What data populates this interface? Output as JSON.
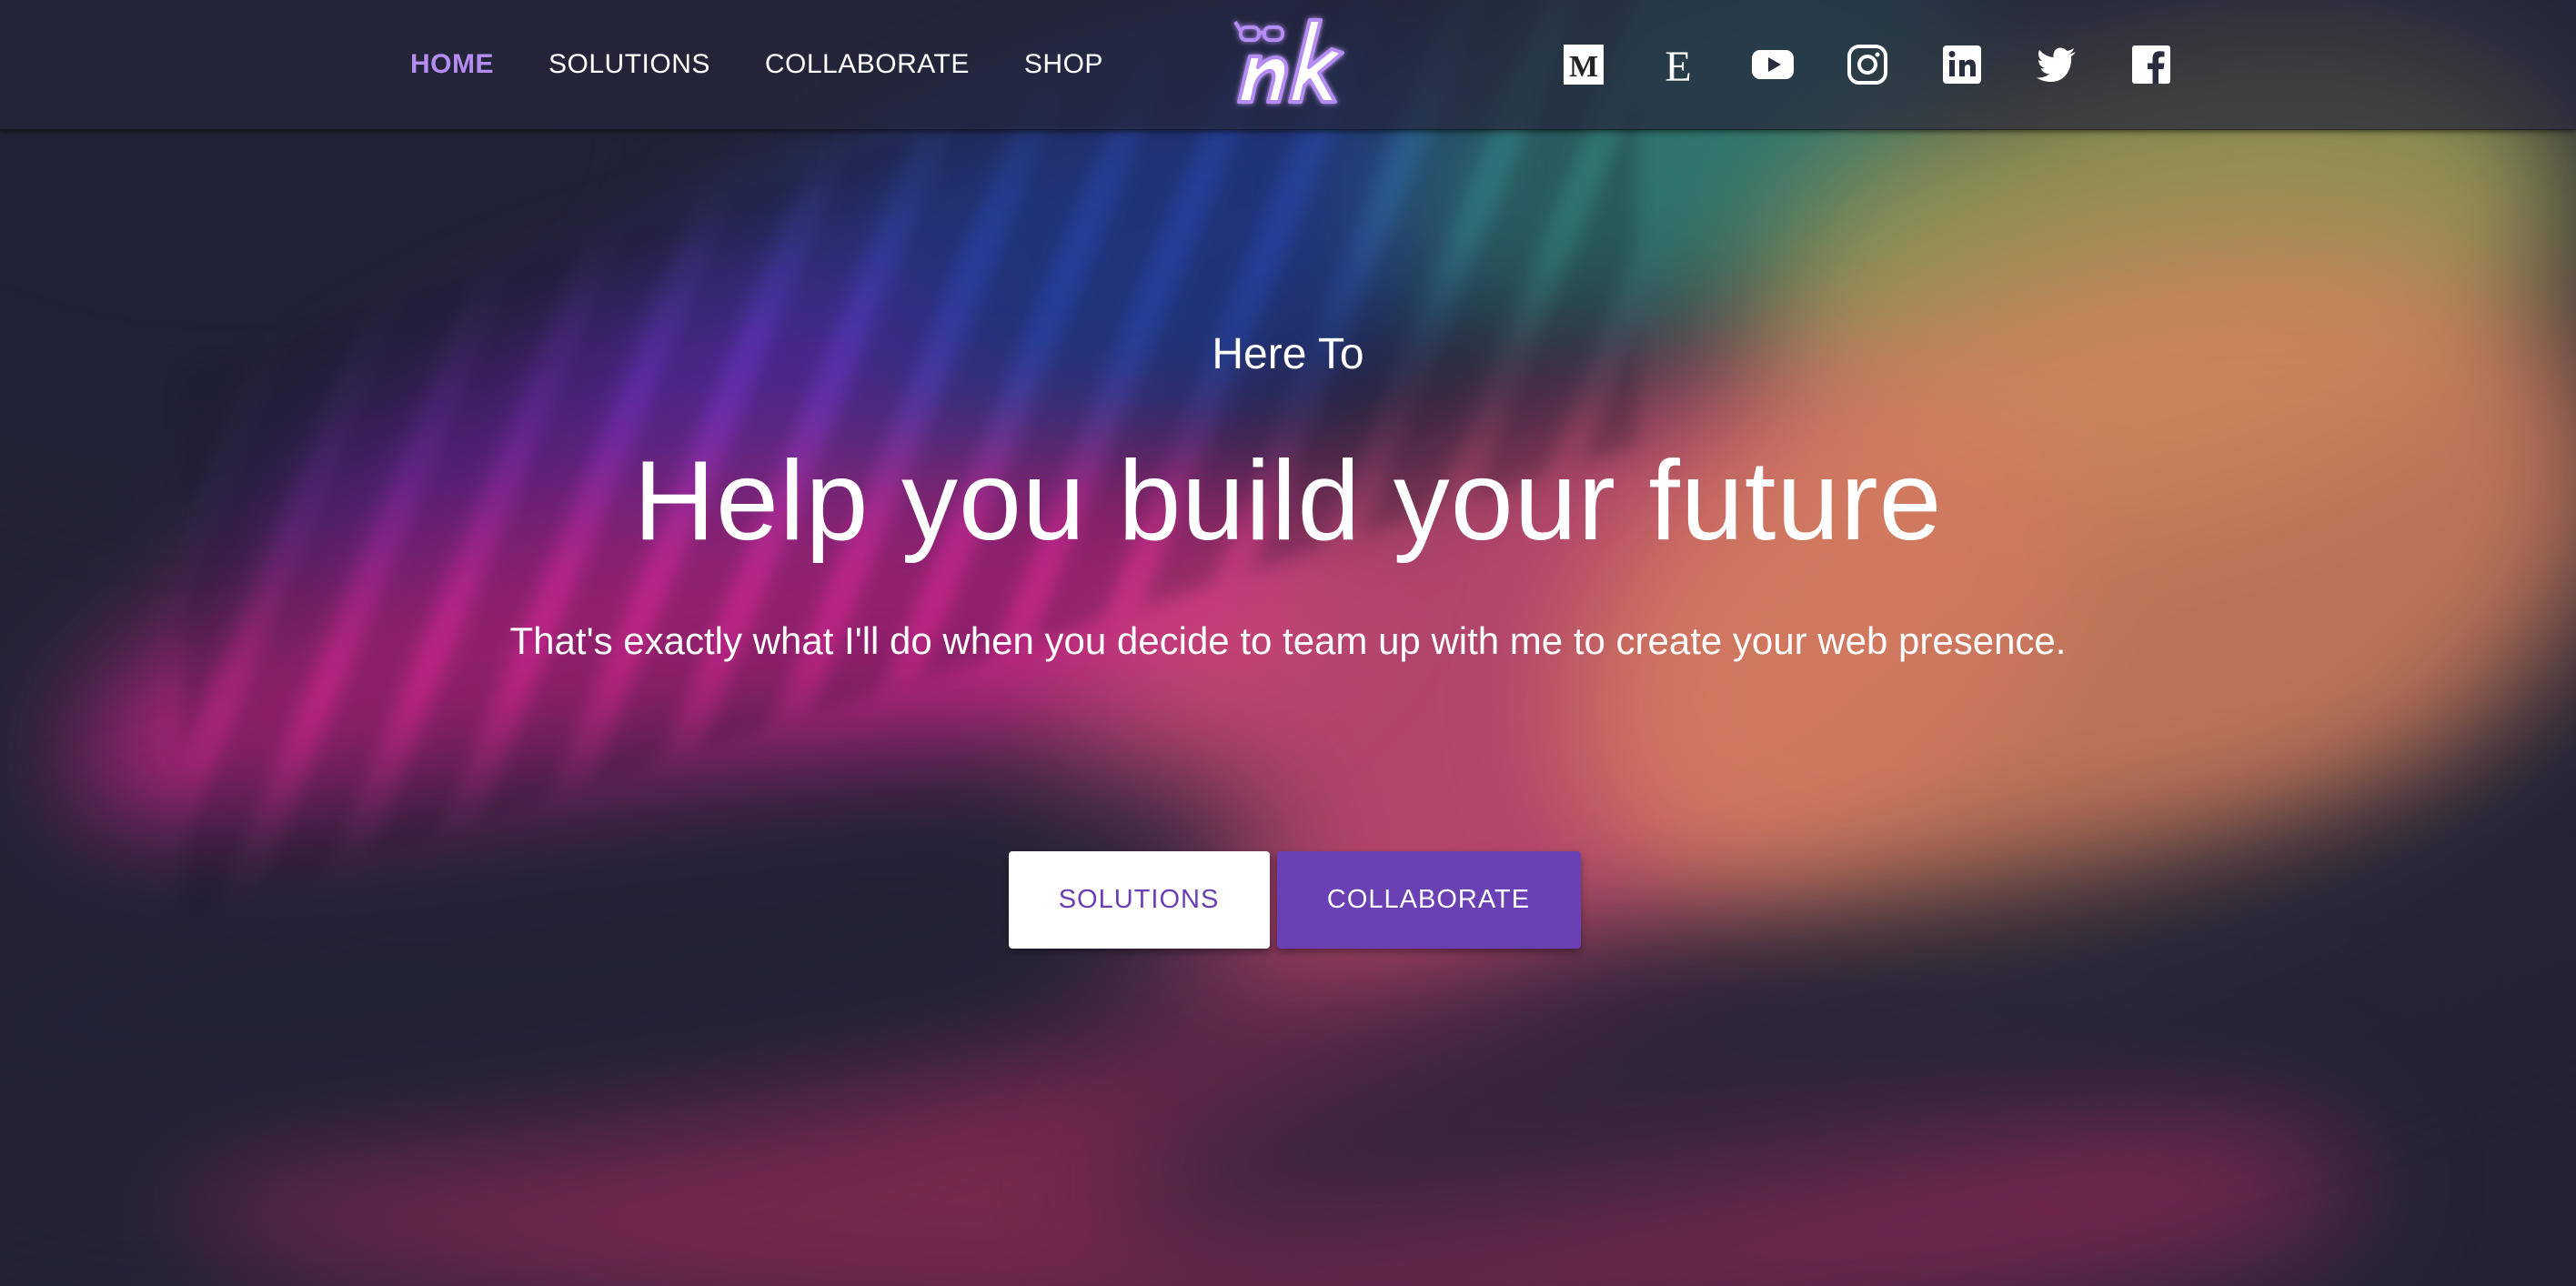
{
  "nav": {
    "items": [
      {
        "label": "HOME",
        "active": true
      },
      {
        "label": "SOLUTIONS",
        "active": false
      },
      {
        "label": "COLLABORATE",
        "active": false
      },
      {
        "label": "SHOP",
        "active": false
      }
    ]
  },
  "logo": {
    "text": "nk",
    "icon": "glasses-icon"
  },
  "social": [
    {
      "name": "medium-icon"
    },
    {
      "name": "etsy-icon"
    },
    {
      "name": "youtube-icon"
    },
    {
      "name": "instagram-icon"
    },
    {
      "name": "linkedin-icon"
    },
    {
      "name": "twitter-icon"
    },
    {
      "name": "facebook-icon"
    }
  ],
  "hero": {
    "eyebrow": "Here To",
    "headline": "Help you build your future",
    "subtitle": "That's exactly what I'll do when you decide to team up with me to create your web presence.",
    "buttons": {
      "solutions": "SOLUTIONS",
      "collaborate": "COLLABORATE"
    }
  },
  "colors": {
    "accent": "#6a40b5",
    "active_nav": "#b48cf2",
    "background": "#262839"
  }
}
